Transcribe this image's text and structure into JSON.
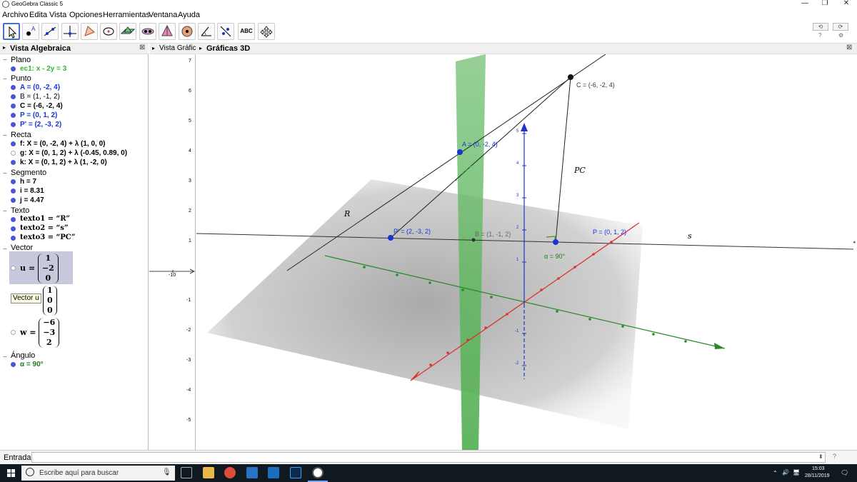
{
  "window": {
    "title": "GeoGebra Classic 5",
    "min": "—",
    "max": "❐",
    "close": "✕"
  },
  "menu": [
    "Archivo",
    "Edita",
    "Vista",
    "Opciones",
    "Herramientas",
    "Ventana",
    "Ayuda"
  ],
  "toolbar": {
    "tools": [
      "move-tool",
      "point-tool",
      "line-tool",
      "perpendicular-tool",
      "polygon-tool",
      "circle-tool",
      "plane-tool",
      "intersect-tool",
      "pyramid-tool",
      "sphere-tool",
      "angle-tool",
      "reflect-tool",
      "text-tool",
      "rotate-view-tool"
    ],
    "text_tool_label": "ABC",
    "undo": "⟲",
    "redo": "⟳",
    "help": "?",
    "settings": "⚙"
  },
  "algebra": {
    "title": "Vista Algebraica",
    "categories": [
      {
        "name": "Plano",
        "items": [
          {
            "text": "ec1: x - 2y = 3",
            "color": "#33b533"
          }
        ]
      },
      {
        "name": "Punto",
        "items": [
          {
            "text": "A = (0, -2, 4)",
            "color": "#1a33d6"
          },
          {
            "text": "B = (1, -1, 2)",
            "color": "#000000"
          },
          {
            "text": "C = (-6, -2, 4)",
            "color": "#000000"
          },
          {
            "text": "P = (0, 1, 2)",
            "color": "#1a33d6"
          },
          {
            "text": "P' = (2, -3, 2)",
            "color": "#1a33d6"
          }
        ]
      },
      {
        "name": "Recta",
        "items": [
          {
            "text": "f: X = (0, -2, 4) + λ (1, 0, 0)",
            "color": "#000000"
          },
          {
            "text": "g: X = (0, 1, 2) + λ (-0.45, 0.89, 0)",
            "color": "#000000"
          },
          {
            "text": "k: X = (0, 1, 2) + λ (1, -2, 0)",
            "color": "#000000"
          }
        ]
      },
      {
        "name": "Segmento",
        "items": [
          {
            "text": "h = 7",
            "color": "#000000"
          },
          {
            "text": "i = 8.31",
            "color": "#000000"
          },
          {
            "text": "j = 4.47",
            "color": "#000000"
          }
        ]
      },
      {
        "name": "Texto",
        "items": [
          {
            "text": "texto1 = “R”",
            "color": "#000000"
          },
          {
            "text": "texto2 = “s”",
            "color": "#000000"
          },
          {
            "text": "texto3 = “PC”",
            "color": "#000000"
          }
        ]
      },
      {
        "name": "Vector"
      },
      {
        "name": "Ángulo",
        "items": [
          {
            "text": "α = 90°",
            "color": "#1f7a1f"
          }
        ]
      }
    ],
    "vectors": {
      "u": {
        "name": "u =",
        "c": [
          "1",
          "−2",
          "0"
        ]
      },
      "tooltip": "Vector u",
      "tip_vec": [
        "1",
        "0",
        "0"
      ],
      "w": {
        "name": "w =",
        "c": [
          "−6",
          "−3",
          "2"
        ]
      }
    }
  },
  "view2d": {
    "title": "Vista Gráfic",
    "yticks": [
      "7",
      "6",
      "5",
      "4",
      "3",
      "2",
      "1",
      "-1",
      "-2",
      "-3",
      "-4",
      "-5"
    ],
    "xtick": "-10"
  },
  "view3d": {
    "title": "Gráficas 3D",
    "labels": {
      "C": "C = (-6, -2, 4)",
      "A": "A = (0, -2, 4)",
      "Pp": "P' = (2, -3, 2)",
      "P": "P = (0, 1, 2)",
      "B": "B = (1, -1, 2)",
      "R": "R",
      "s": "s",
      "PC": "PC",
      "alpha": "α = 90°"
    },
    "zticks": [
      "5",
      "4",
      "3",
      "2",
      "1",
      "-1",
      "-2"
    ]
  },
  "input": {
    "label": "Entrada:",
    "value": "",
    "help": "?",
    "arrow": "⬍"
  },
  "taskbar": {
    "search_placeholder": "Escribe aquí para buscar",
    "time": "15:03",
    "date": "28/11/2019"
  }
}
